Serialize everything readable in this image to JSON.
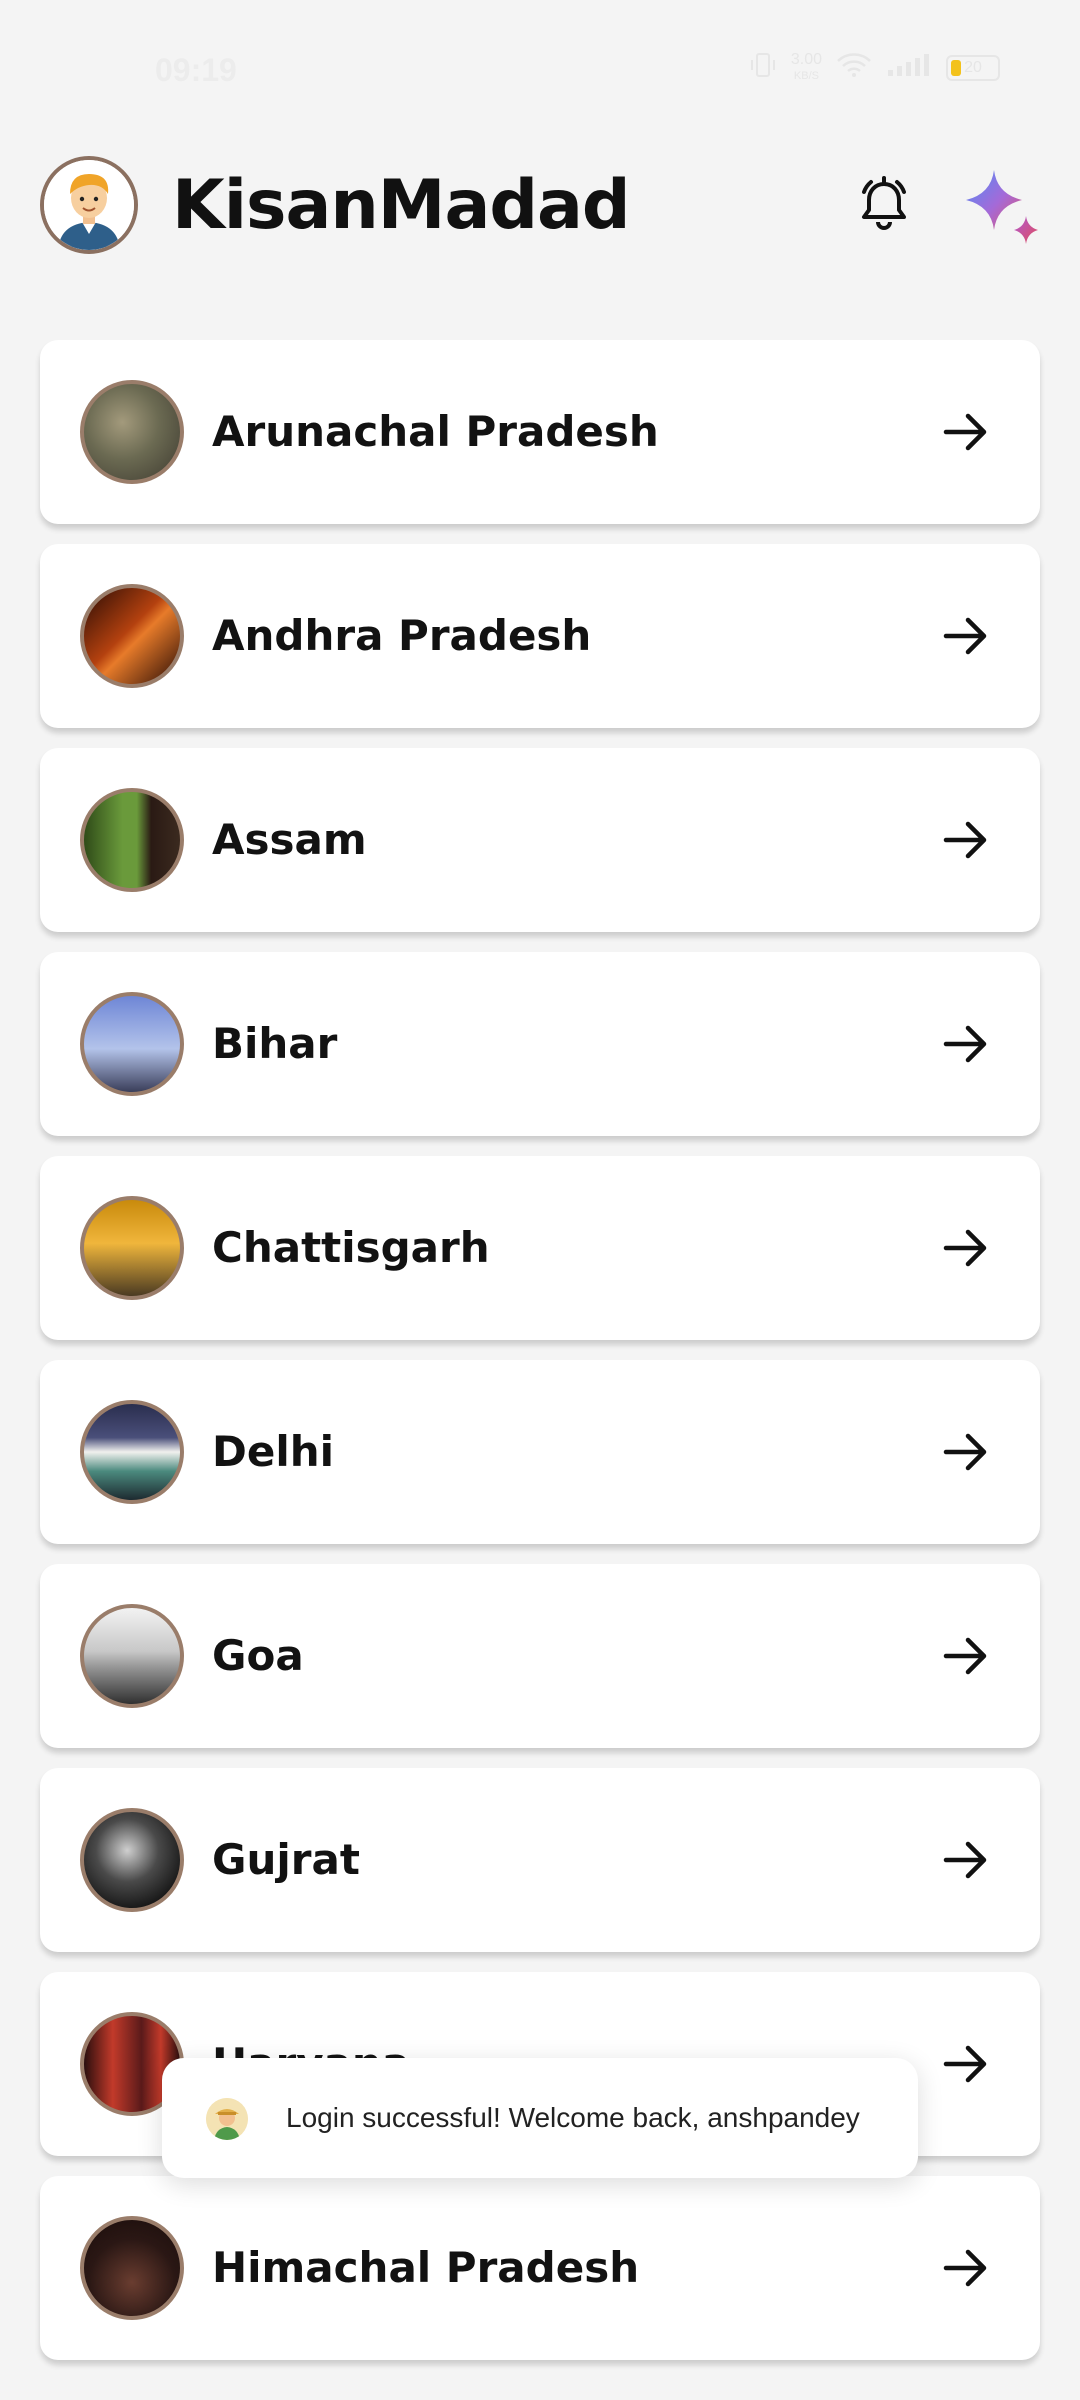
{
  "status_bar": {
    "time": "09:19",
    "net_speed_value": "3.00",
    "net_speed_unit": "KB/S",
    "battery_level": "20"
  },
  "header": {
    "app_title": "KisanMadad",
    "avatar_icon": "farmer-avatar-icon",
    "bell_icon": "notification-bell-icon",
    "ai_icon": "ai-sparkle-icon"
  },
  "states": [
    {
      "name": "Arunachal Pradesh",
      "thumb_colors": [
        "#3e3a30",
        "#6b6a52",
        "#a39a7c"
      ]
    },
    {
      "name": "Andhra Pradesh",
      "thumb_colors": [
        "#2a0c05",
        "#b4410f",
        "#e77b2a"
      ]
    },
    {
      "name": "Assam",
      "thumb_colors": [
        "#2f4b18",
        "#6a9a3b",
        "#2a1a14"
      ]
    },
    {
      "name": "Bihar",
      "thumb_colors": [
        "#6e86d6",
        "#b3c3ea",
        "#3a3e5a"
      ]
    },
    {
      "name": "Chattisgarh",
      "thumb_colors": [
        "#c98a0c",
        "#f0b63c",
        "#4a3a22"
      ]
    },
    {
      "name": "Delhi",
      "thumb_colors": [
        "#2a2e4e",
        "#f1f1ee",
        "#4b8a7e"
      ]
    },
    {
      "name": "Goa",
      "thumb_colors": [
        "#f2f2f2",
        "#9a9a9a",
        "#303030"
      ]
    },
    {
      "name": "Gujrat",
      "thumb_colors": [
        "#111111",
        "#cfcfcf",
        "#4a4a4a"
      ]
    },
    {
      "name": "Haryana",
      "thumb_colors": [
        "#5a1a1a",
        "#c23a2a",
        "#2a0e0e"
      ]
    },
    {
      "name": "Himachal Pradesh",
      "thumb_colors": [
        "#2a1714",
        "#6a3d30",
        "#1a0d0b"
      ]
    }
  ],
  "toast": {
    "message": "Login successful! Welcome back, anshpandey"
  }
}
